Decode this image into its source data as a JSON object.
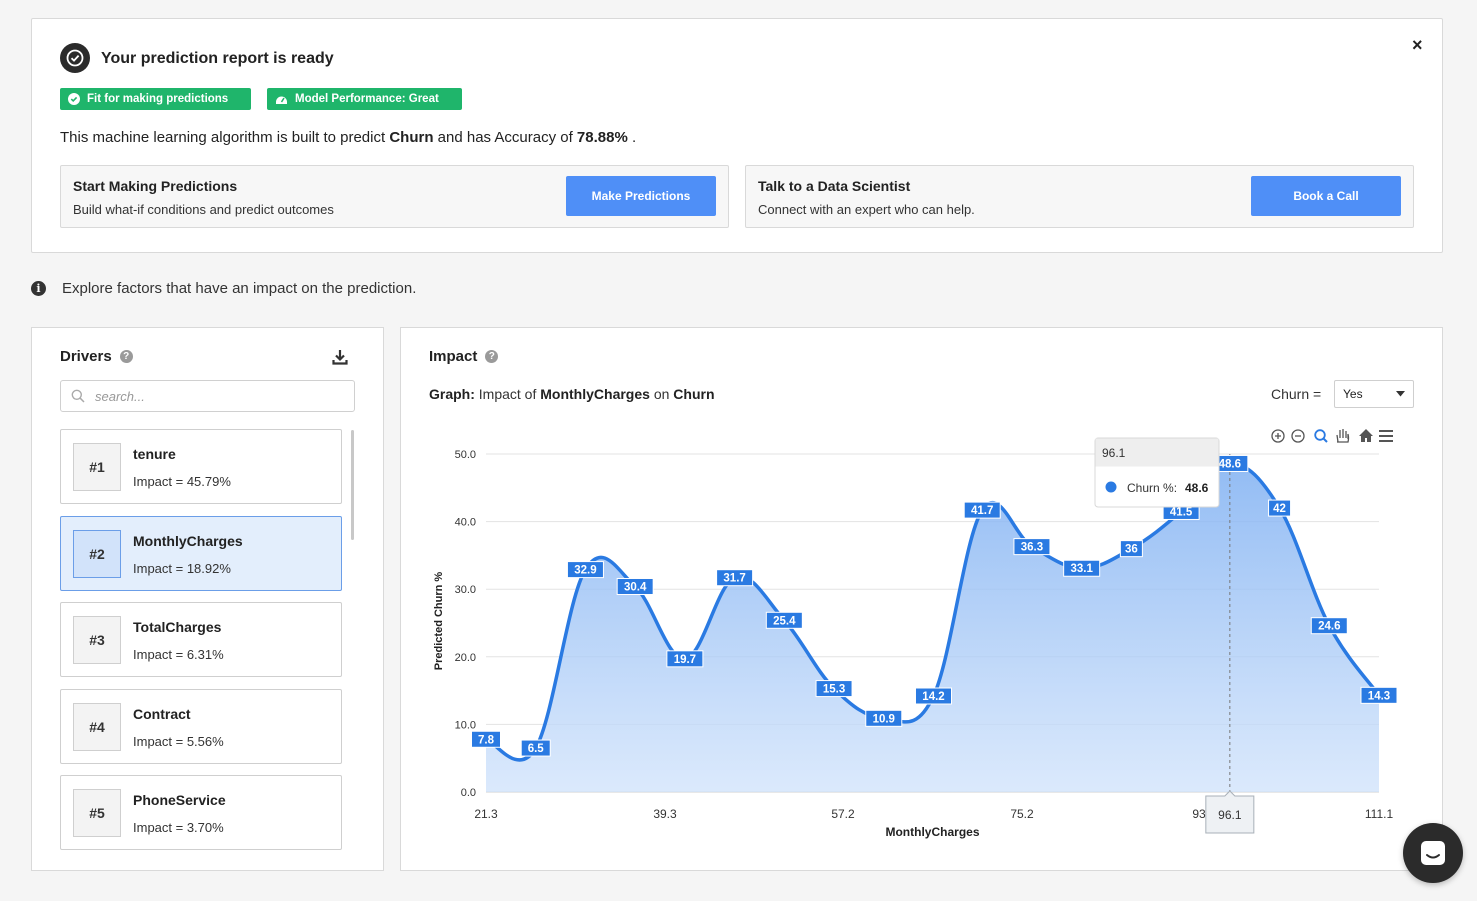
{
  "report": {
    "title": "Your prediction report is ready",
    "badge_fit": "Fit for making predictions",
    "badge_performance": "Model Performance: Great",
    "summary_prefix": "This machine learning algorithm is built to predict ",
    "summary_target": "Churn",
    "summary_middle": " and has Accuracy of ",
    "summary_accuracy": "78.88%",
    "summary_suffix": " .",
    "start_title": "Start Making Predictions",
    "start_sub": "Build what-if conditions and predict outcomes",
    "start_button": "Make Predictions",
    "talk_title": "Talk to a Data Scientist",
    "talk_sub": "Connect with an expert who can help.",
    "talk_button": "Book a Call",
    "close": "×"
  },
  "explore_text": "Explore factors that have an impact on the prediction.",
  "drivers": {
    "title": "Drivers",
    "search_placeholder": "search...",
    "items": [
      {
        "rank": "#1",
        "name": "tenure",
        "impact": "Impact = 45.79%"
      },
      {
        "rank": "#2",
        "name": "MonthlyCharges",
        "impact": "Impact = 18.92%"
      },
      {
        "rank": "#3",
        "name": "TotalCharges",
        "impact": "Impact = 6.31%"
      },
      {
        "rank": "#4",
        "name": "Contract",
        "impact": "Impact = 5.56%"
      },
      {
        "rank": "#5",
        "name": "PhoneService",
        "impact": "Impact = 3.70%"
      }
    ],
    "active_index": 1
  },
  "impact": {
    "title": "Impact",
    "graph_prefix": "Graph:",
    "graph_text1": " Impact of ",
    "graph_feature": "MonthlyCharges",
    "graph_text2": " on ",
    "graph_target": "Churn",
    "select_label": "Churn =",
    "select_value": "Yes"
  },
  "colors": {
    "accent": "#4f8ff7",
    "badge": "#1fb56b",
    "line": "#2a7ae2"
  },
  "chart_data": {
    "type": "area",
    "xlabel": "MonthlyCharges",
    "ylabel": "Predicted Churn %",
    "x_ticks": [
      "21.3",
      "39.3",
      "57.2",
      "75.2",
      "93",
      "111.1"
    ],
    "y_ticks": [
      "0.0",
      "10.0",
      "20.0",
      "30.0",
      "40.0",
      "50.0"
    ],
    "xlim": [
      21.3,
      111.1
    ],
    "ylim": [
      0,
      50
    ],
    "grid": true,
    "series": [
      {
        "name": "Churn %",
        "x": [
          21.3,
          26.3,
          31.3,
          36.3,
          41.3,
          46.3,
          51.3,
          56.3,
          61.3,
          66.3,
          71.2,
          76.2,
          81.2,
          86.2,
          91.2,
          96.1,
          101.1,
          106.1,
          111.1
        ],
        "values": [
          7.8,
          6.5,
          32.9,
          30.4,
          19.7,
          31.7,
          25.4,
          15.3,
          10.9,
          14.2,
          41.7,
          36.3,
          33.1,
          36,
          41.5,
          48.6,
          42,
          24.6,
          14.3
        ],
        "labels": [
          "7.8",
          "6.5",
          "32.9",
          "30.4",
          "19.7",
          "31.7",
          "25.4",
          "15.3",
          "10.9",
          "14.2",
          "41.7",
          "36.3",
          "33.1",
          "36",
          "41.5",
          "48.6",
          "42",
          "24.6",
          "14.3"
        ]
      }
    ],
    "tooltip": {
      "x_label": "96.1",
      "series_label": "Churn %:",
      "value": "48.6",
      "crosshair_x": 96.1
    }
  }
}
